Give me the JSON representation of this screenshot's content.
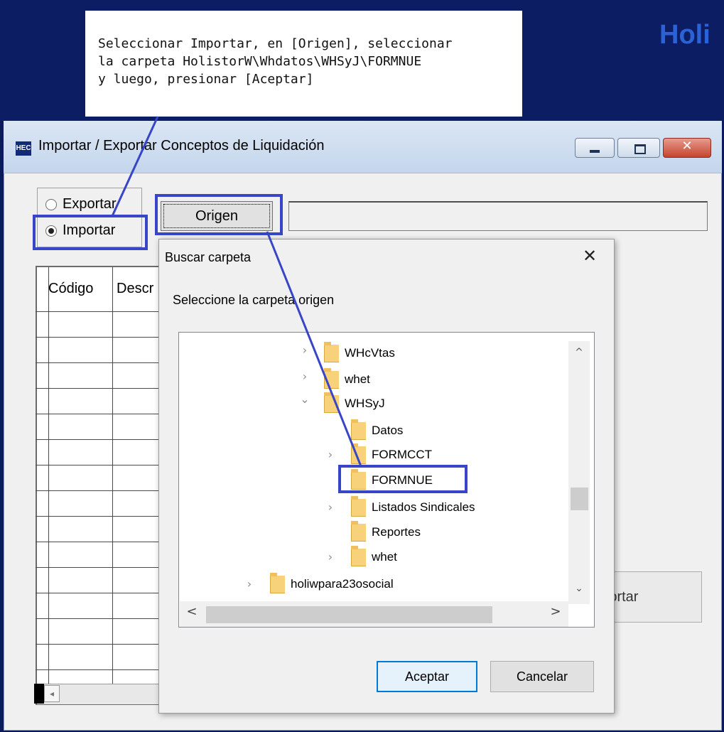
{
  "brand": {
    "text": "Holi"
  },
  "callout": {
    "lines": [
      "Seleccionar Importar, en [Origen], seleccionar",
      "la carpeta HolistorW\\Whdatos\\WHSyJ\\FORMNUE",
      "y luego, presionar [Aceptar]"
    ]
  },
  "window": {
    "icon_text": "HEC",
    "title": "Importar / Exportar Conceptos de Liquidación",
    "close_glyph": "✕"
  },
  "mode": {
    "exportar_label": "Exportar",
    "importar_label": "Importar",
    "selected": "Importar"
  },
  "origen_button": {
    "label": "Origen"
  },
  "path_field": {
    "value": ""
  },
  "grid": {
    "columns": [
      "Código",
      "Descr"
    ]
  },
  "importar_button": {
    "label": "Importar"
  },
  "dialog": {
    "title": "Buscar carpeta",
    "close_glyph": "✕",
    "prompt": "Seleccione la carpeta origen",
    "tree": [
      {
        "label": "WHcVtas",
        "expander": "›"
      },
      {
        "label": "whet",
        "expander": "›"
      },
      {
        "label": "WHSyJ",
        "expander": "⌄"
      },
      {
        "label": "Datos",
        "expander": ""
      },
      {
        "label": "FORMCCT",
        "expander": "›"
      },
      {
        "label": "FORMNUE",
        "expander": "",
        "selected": true
      },
      {
        "label": "Listados Sindicales",
        "expander": "›"
      },
      {
        "label": "Reportes",
        "expander": ""
      },
      {
        "label": "whet",
        "expander": "›"
      },
      {
        "label": "holiwpara23osocial",
        "expander": "›"
      }
    ],
    "scroll": {
      "up": "^",
      "down": "⌄",
      "left": "<",
      "right": ">"
    },
    "accept_label": "Aceptar",
    "cancel_label": "Cancelar"
  },
  "grid_scroll": {
    "left": "◂"
  },
  "colors": {
    "annotation": "#3845c7",
    "banner": "#0c1d63",
    "brand": "#2b62d6"
  }
}
